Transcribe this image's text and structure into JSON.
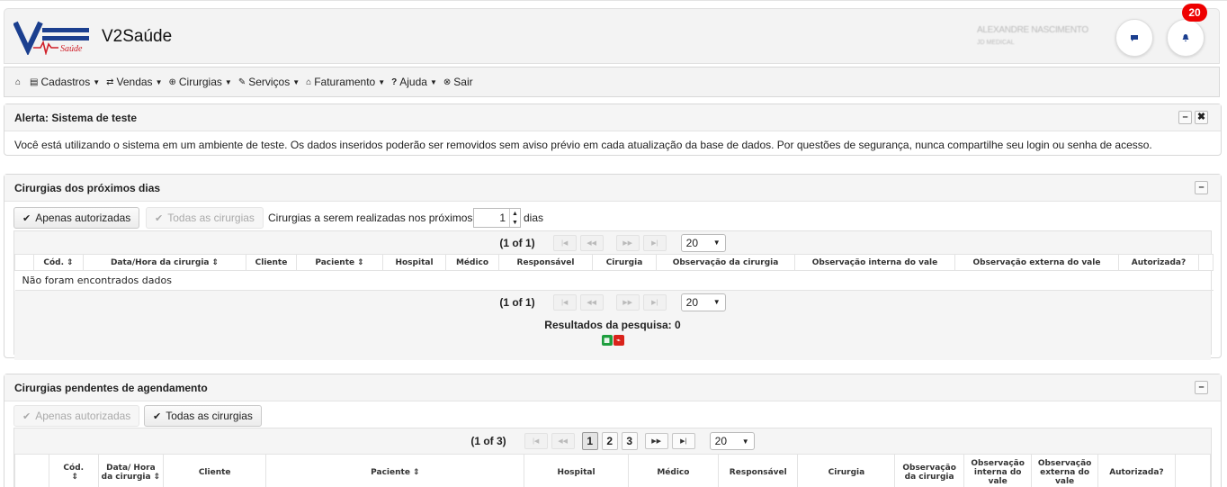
{
  "app": {
    "title": "V2Saúde",
    "logo_text": "V2",
    "logo_sub": "Saúde"
  },
  "user": {
    "name": "ALEXANDRE NASCIMENTO",
    "company": "JD MEDICAL"
  },
  "notifications": {
    "count": "20"
  },
  "menu": [
    {
      "label": "",
      "icon": "home-icon"
    },
    {
      "label": "Cadastros",
      "icon": "card-icon"
    },
    {
      "label": "Vendas",
      "icon": "exchange-icon"
    },
    {
      "label": "Cirurgias",
      "icon": "plus-circle-icon"
    },
    {
      "label": "Serviços",
      "icon": "wrench-icon"
    },
    {
      "label": "Faturamento",
      "icon": "bank-icon"
    },
    {
      "label": "Ajuda",
      "icon": "question-icon"
    },
    {
      "label": "Sair",
      "icon": "close-circle-icon"
    }
  ],
  "alert": {
    "title": "Alerta: Sistema de teste",
    "message": "Você está utilizando o sistema em um ambiente de teste. Os dados inseridos poderão ser removidos sem aviso prévio em cada atualização da base de dados. Por questões de segurança, nunca compartilhe seu login ou senha de acesso."
  },
  "upcoming": {
    "title": "Cirurgias dos próximos dias",
    "btn_authorized": "Apenas autorizadas",
    "btn_all": "Todas as cirurgias",
    "days_label": "Cirurgias a serem realizadas nos próximos",
    "days_value": "1",
    "days_suffix": "dias",
    "pager_text": "(1 of 1)",
    "rows_per_page": "20",
    "columns": [
      "",
      "Cód.",
      "Data/Hora da cirurgia",
      "Cliente",
      "Paciente",
      "Hospital",
      "Médico",
      "Responsável",
      "Cirurgia",
      "Observação da cirurgia",
      "Observação interna do vale",
      "Observação externa do vale",
      "Autorizada?",
      ""
    ],
    "empty_text": "Não foram encontrados dados",
    "results_text": "Resultados da pesquisa: 0"
  },
  "pending": {
    "title": "Cirurgias pendentes de agendamento",
    "btn_authorized": "Apenas autorizadas",
    "btn_all": "Todas as cirurgias",
    "pager_text": "(1 of 3)",
    "pages": [
      "1",
      "2",
      "3"
    ],
    "rows_per_page": "20",
    "columns": [
      "",
      "Cód.",
      "Data/ Hora da cirurgia",
      "Cliente",
      "Paciente",
      "Hospital",
      "Médico",
      "Responsável",
      "Cirurgia",
      "Observação da cirurgia",
      "Observação interna do vale",
      "Observação externa do vale",
      "Autorizada?",
      ""
    ]
  },
  "colors": {
    "badge": "#e00000",
    "excel": "#1e9e3e",
    "pdf": "#d9231b",
    "logo_blue": "#1b3f8f",
    "logo_red": "#d0202a"
  }
}
